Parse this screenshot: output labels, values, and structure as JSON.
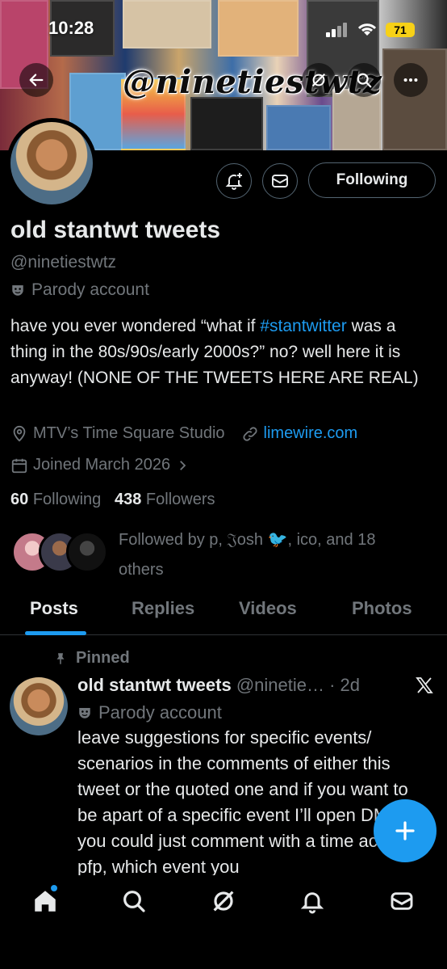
{
  "status_bar": {
    "time": "10:28",
    "battery": "71"
  },
  "banner": {
    "title": "@ninetiestwtz"
  },
  "profile": {
    "name": "old stantwt tweets",
    "handle": "@ninetiestwtz",
    "label": "Parody account",
    "bio_before": "have you ever wondered “what if ",
    "bio_hashtag": "#stantwitter",
    "bio_after": " was a thing in the 80s/90s/early 2000s?” no? well here it is anyway! (NONE OF THE TWEETS HERE ARE REAL)",
    "location": "MTV’s Time Square Studio",
    "website": "limewire.com",
    "joined": "Joined March 2026",
    "following_count": "60",
    "following_label": "Following",
    "followers_count": "438",
    "followers_label": "Followers",
    "followed_by": "Followed by p, 𝔍osh 🐦, ico, and 18 others"
  },
  "actions": {
    "following_button": "Following"
  },
  "tabs": [
    {
      "label": "Posts",
      "active": true
    },
    {
      "label": "Replies",
      "active": false
    },
    {
      "label": "Videos",
      "active": false
    },
    {
      "label": "Photos",
      "active": false
    }
  ],
  "pinned_tweet": {
    "pinned_label": "Pinned",
    "author": "old stantwt tweets",
    "handle_time": "@ninetie… · 2d",
    "label": "Parody account",
    "text": "leave suggestions for specific events/ scenarios in the comments of either this tweet or the quoted one and if you want to be apart of a specific event I’ll open DMs or you could just comment with a time accurate pfp, which event you"
  },
  "colors": {
    "accent": "#1d9bf0",
    "muted": "#71767b",
    "text": "#e7e9ea",
    "background": "#000000",
    "battery": "#f7d117"
  },
  "icons": [
    "back-arrow-icon",
    "grok-icon",
    "search-icon",
    "more-icon",
    "notification-bell-add-icon",
    "message-icon",
    "pin-icon",
    "x-logo-icon",
    "plus-icon",
    "home-icon",
    "explore-search-icon",
    "grok-nav-icon",
    "notifications-icon",
    "messages-icon"
  ]
}
